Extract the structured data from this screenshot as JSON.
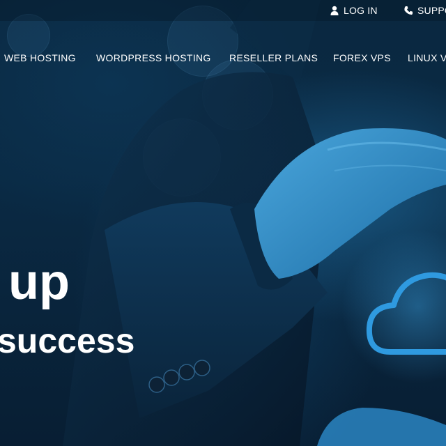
{
  "topbar": {
    "login_label": "LOG IN",
    "support_label": "SUPPO"
  },
  "nav": {
    "items": [
      {
        "label": "WEB HOSTING"
      },
      {
        "label": "WORDPRESS HOSTING"
      },
      {
        "label": "RESELLER PLANS"
      },
      {
        "label": "FOREX VPS"
      },
      {
        "label": "LINUX V"
      }
    ]
  },
  "hero": {
    "headline_line1": "up",
    "headline_line2": "success"
  },
  "colors": {
    "background": "#061a2b",
    "accent": "#2f8fd0",
    "text": "#ffffff"
  },
  "icons": {
    "login": "user-icon",
    "support": "phone-icon",
    "hero_graphic": "cloud-icon"
  }
}
